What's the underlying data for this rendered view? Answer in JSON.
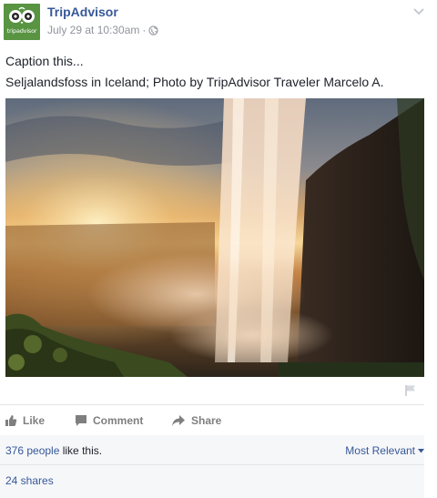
{
  "post": {
    "page_name": "TripAdvisor",
    "logo_text": "tripadvisor",
    "date": "July 29 at 10:30am",
    "separator": "·",
    "caption": "Caption this...",
    "description": "Seljalandsfoss in Iceland; Photo by TripAdvisor Traveler Marcelo A."
  },
  "actions": {
    "like": "Like",
    "comment": "Comment",
    "share": "Share"
  },
  "footer": {
    "like_count": "376 people",
    "like_suffix": " like this.",
    "sort_label": "Most Relevant",
    "shares": "24 shares"
  },
  "colors": {
    "link_blue": "#365899",
    "tripadvisor_green": "#589442",
    "meta_gray": "#90949c"
  },
  "icons": [
    "tripadvisor-owl-icon",
    "globe-icon",
    "chevron-down-icon",
    "flag-icon",
    "thumbs-up-icon",
    "comment-icon",
    "share-arrow-icon",
    "caret-down-icon"
  ]
}
